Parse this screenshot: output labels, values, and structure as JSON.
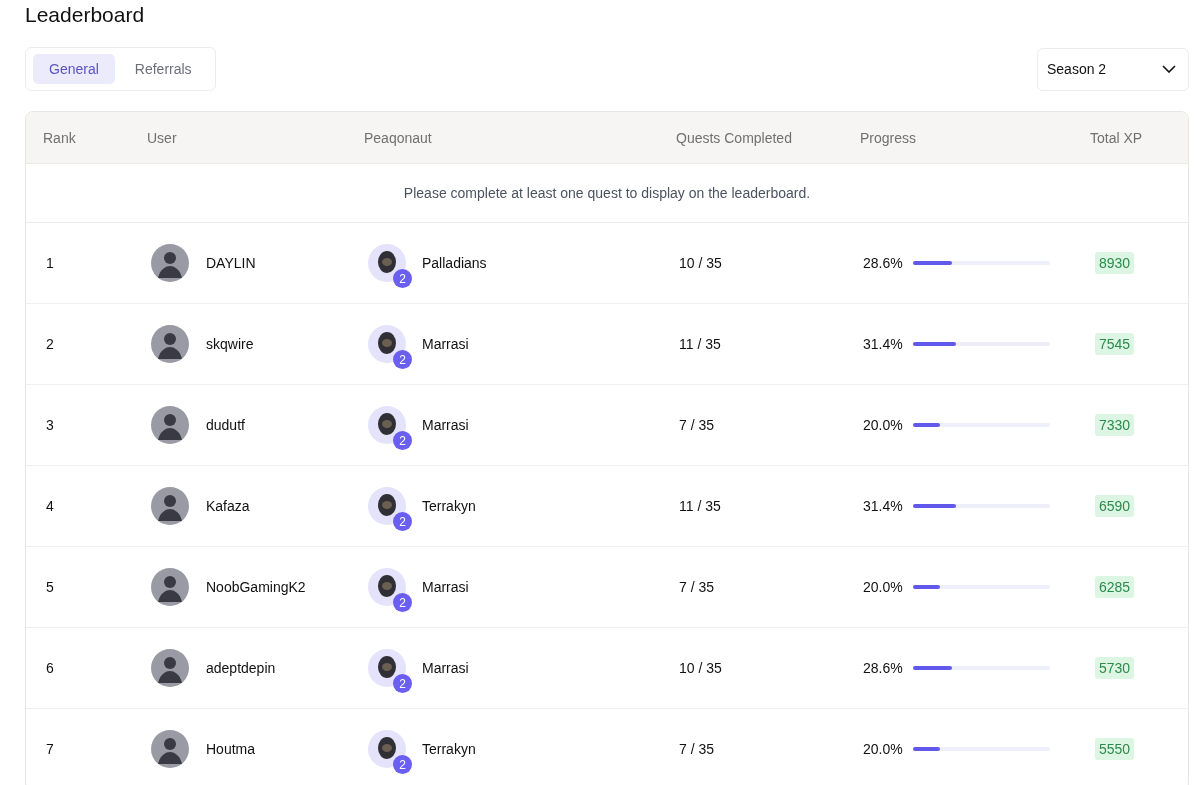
{
  "title": "Leaderboard",
  "tabs": [
    {
      "label": "General",
      "selected": true
    },
    {
      "label": "Referrals",
      "selected": false
    }
  ],
  "season_select": {
    "value": "Season 2"
  },
  "table": {
    "columns": [
      "Rank",
      "User",
      "Peaqonaut",
      "Quests Completed",
      "Progress",
      "Total XP"
    ],
    "notice": "Please complete at least one quest to display on the leaderboard.",
    "rows": [
      {
        "rank": "1",
        "user": "DAYLIN",
        "peaqonaut": "Palladians",
        "badge": "2",
        "quests": "10 / 35",
        "progress": "28.6%",
        "level": 0.286,
        "xp": "8930"
      },
      {
        "rank": "2",
        "user": "skqwire",
        "peaqonaut": "Marrasi",
        "badge": "2",
        "quests": "11 / 35",
        "progress": "31.4%",
        "level": 0.314,
        "xp": "7545"
      },
      {
        "rank": "3",
        "user": "dudutf",
        "peaqonaut": "Marrasi",
        "badge": "2",
        "quests": "7 / 35",
        "progress": "20.0%",
        "level": 0.2,
        "xp": "7330"
      },
      {
        "rank": "4",
        "user": "Kafaza",
        "peaqonaut": "Terrakyn",
        "badge": "2",
        "quests": "11 / 35",
        "progress": "31.4%",
        "level": 0.314,
        "xp": "6590"
      },
      {
        "rank": "5",
        "user": "NoobGamingK2",
        "peaqonaut": "Marrasi",
        "badge": "2",
        "quests": "7 / 35",
        "progress": "20.0%",
        "level": 0.2,
        "xp": "6285"
      },
      {
        "rank": "6",
        "user": "adeptdepin",
        "peaqonaut": "Marrasi",
        "badge": "2",
        "quests": "10 / 35",
        "progress": "28.6%",
        "level": 0.286,
        "xp": "5730"
      },
      {
        "rank": "7",
        "user": "Houtma",
        "peaqonaut": "Terrakyn",
        "badge": "2",
        "quests": "7 / 35",
        "progress": "20.0%",
        "level": 0.2,
        "xp": "5550"
      }
    ]
  }
}
